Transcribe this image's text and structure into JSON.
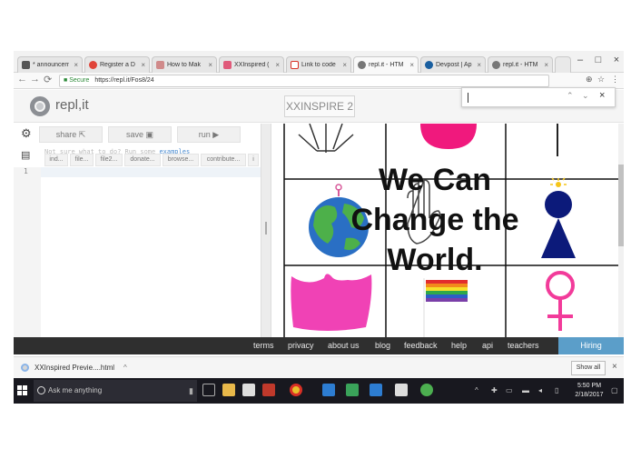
{
  "browser": {
    "tabs": [
      {
        "label": "* announcem",
        "color": "#555555"
      },
      {
        "label": "Register a D",
        "color": "#e0453a"
      },
      {
        "label": "How to Mak",
        "color": "#d08a8a"
      },
      {
        "label": "XXInspired (",
        "color": "#e05a7a"
      },
      {
        "label": "Link to code",
        "color": "#d93025"
      },
      {
        "label": "repl.it - HTM",
        "color": "#555555"
      },
      {
        "label": "Devpost | Ap",
        "color": "#1a5fa0"
      },
      {
        "label": "repl.it - HTM",
        "color": "#555555"
      }
    ],
    "active_tab_index": 5,
    "tab_close": "×",
    "secure_label": "Secure",
    "url": "https://repl.it/Fos8/24",
    "nav": {
      "back": "←",
      "forward": "→",
      "reload": "⟳"
    }
  },
  "findbar": {
    "up": "⌃",
    "down": "⌄",
    "close": "×"
  },
  "header": {
    "logo_text": "repl,it",
    "project_title": "XXINSPIRE 2"
  },
  "toolbar": {
    "share_label": "share",
    "save_label": "save",
    "run_label": "run"
  },
  "editor": {
    "hint_text": "Not sure what to do? Run some",
    "hint_link": "examples",
    "file_tabs": [
      "ind...",
      "file...",
      "file2...",
      "donate...",
      "browse...",
      "contribute...",
      "i"
    ],
    "line_numbers": [
      "1"
    ]
  },
  "preview": {
    "headline": [
      "We Can",
      "Change the",
      "World."
    ]
  },
  "footer": {
    "links": [
      "terms",
      "privacy",
      "about us",
      "blog",
      "feedback",
      "help",
      "api",
      "teachers"
    ],
    "hiring_label": "Hiring"
  },
  "downloads": {
    "file_name": "XXInspired Previe....html",
    "show_all_label": "Show all"
  },
  "taskbar": {
    "search_placeholder": "Ask me anything",
    "time": "5:50 PM",
    "date": "2/18/2017"
  },
  "colors": {
    "accent": "#5b9ec9",
    "footer_bg": "#2f2f2f",
    "taskbar_bg": "#18181f",
    "pink": "#f23b9a",
    "navy": "#0c1a7a"
  }
}
